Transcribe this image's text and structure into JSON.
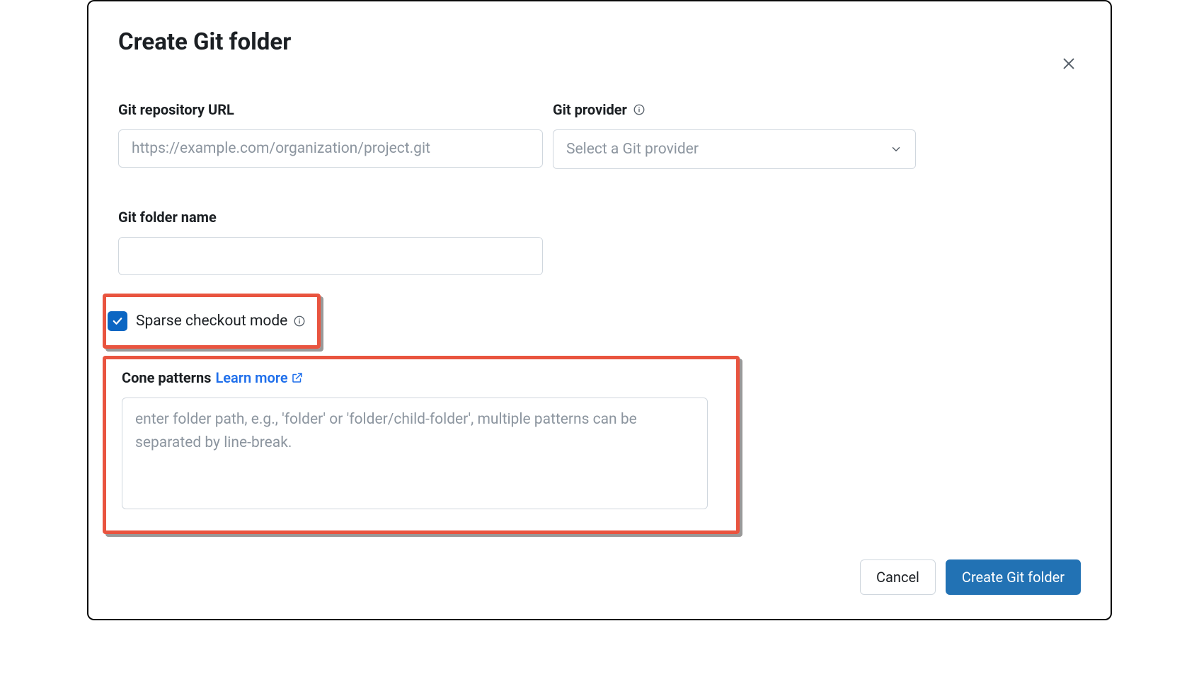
{
  "dialog": {
    "title": "Create Git folder"
  },
  "fields": {
    "repo_url_label": "Git repository URL",
    "repo_url_placeholder": "https://example.com/organization/project.git",
    "repo_url_value": "",
    "provider_label": "Git provider",
    "provider_placeholder": "Select a Git provider",
    "provider_value": "",
    "folder_name_label": "Git folder name",
    "folder_name_value": ""
  },
  "sparse": {
    "checkbox_checked": true,
    "label": "Sparse checkout mode"
  },
  "cone": {
    "label": "Cone patterns",
    "learn_more": "Learn more",
    "placeholder": "enter folder path, e.g., 'folder' or 'folder/child-folder', multiple patterns can be separated by line-break.",
    "value": ""
  },
  "footer": {
    "cancel": "Cancel",
    "create": "Create Git folder"
  }
}
